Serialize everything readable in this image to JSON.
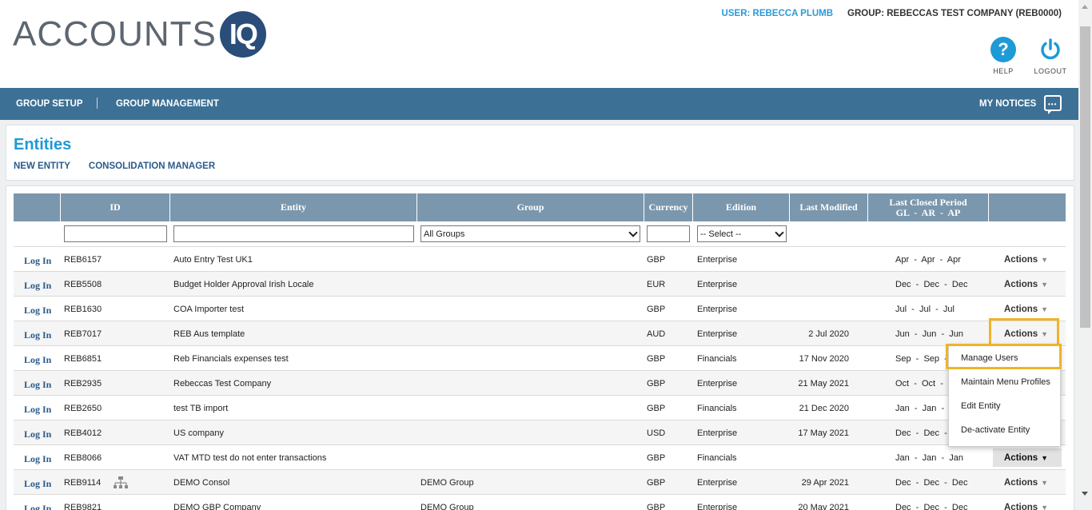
{
  "header": {
    "logo_text": "ACCOUNTS",
    "logo_badge": "IQ",
    "user": "USER: REBECCA PLUMB",
    "group": "GROUP: REBECCAS TEST COMPANY (REB0000)",
    "help_label": "HELP",
    "logout_label": "LOGOUT"
  },
  "nav": {
    "group_setup": "GROUP SETUP",
    "group_management": "GROUP MANAGEMENT",
    "my_notices": "MY NOTICES"
  },
  "page": {
    "title": "Entities",
    "new_entity": "NEW ENTITY",
    "consolidation_manager": "CONSOLIDATION MANAGER"
  },
  "table": {
    "headers": {
      "id": "ID",
      "entity": "Entity",
      "group": "Group",
      "currency": "Currency",
      "edition": "Edition",
      "last_modified": "Last Modified",
      "last_closed_line1": "Last Closed Period",
      "last_closed_line2": "GL  -  AR  -  AP"
    },
    "filters": {
      "group_selected": "All Groups",
      "edition_selected": "-- Select --"
    },
    "login_label": "Log In",
    "actions_label": "Actions",
    "rows": [
      {
        "id": "REB6157",
        "entity": "Auto Entry Test UK1",
        "group": "",
        "currency": "GBP",
        "edition": "Enterprise",
        "modified": "",
        "period": "Apr  -  Apr  -  Apr"
      },
      {
        "id": "REB5508",
        "entity": "Budget Holder Approval Irish Locale",
        "group": "",
        "currency": "EUR",
        "edition": "Enterprise",
        "modified": "",
        "period": "Dec  -  Dec  -  Dec"
      },
      {
        "id": "REB1630",
        "entity": "COA Importer test",
        "group": "",
        "currency": "GBP",
        "edition": "Enterprise",
        "modified": "",
        "period": "Jul  -  Jul  -  Jul"
      },
      {
        "id": "REB7017",
        "entity": "REB Aus template",
        "group": "",
        "currency": "AUD",
        "edition": "Enterprise",
        "modified": "2 Jul 2020",
        "period": "Jun  -  Jun  -  Jun"
      },
      {
        "id": "REB6851",
        "entity": "Reb Financials expenses test",
        "group": "",
        "currency": "GBP",
        "edition": "Financials",
        "modified": "17 Nov 2020",
        "period": "Sep  -  Sep  -"
      },
      {
        "id": "REB2935",
        "entity": "Rebeccas Test Company",
        "group": "",
        "currency": "GBP",
        "edition": "Enterprise",
        "modified": "21 May 2021",
        "period": "Oct  -  Oct  -"
      },
      {
        "id": "REB2650",
        "entity": "test TB import",
        "group": "",
        "currency": "GBP",
        "edition": "Financials",
        "modified": "21 Dec 2020",
        "period": "Jan  -  Jan  -"
      },
      {
        "id": "REB4012",
        "entity": "US company",
        "group": "",
        "currency": "USD",
        "edition": "Enterprise",
        "modified": "17 May 2021",
        "period": "Dec  -  Dec  -"
      },
      {
        "id": "REB8066",
        "entity": "VAT MTD test do not enter transactions",
        "group": "",
        "currency": "GBP",
        "edition": "Financials",
        "modified": "",
        "period": "Jan  -  Jan  -  Jan"
      },
      {
        "id": "REB9114",
        "entity": "DEMO Consol",
        "group": "DEMO Group",
        "currency": "GBP",
        "edition": "Enterprise",
        "modified": "29 Apr 2021",
        "period": "Dec  -  Dec  -  Dec"
      },
      {
        "id": "REB9821",
        "entity": "DEMO GBP Company",
        "group": "DEMO Group",
        "currency": "GBP",
        "edition": "Enterprise",
        "modified": "20 May 2021",
        "period": "Dec  -  Dec  -  Dec"
      }
    ]
  },
  "menu": {
    "items": [
      "Manage Users",
      "Maintain Menu Profiles",
      "Edit Entity",
      "De-activate Entity"
    ]
  },
  "colors": {
    "accent": "#1e9ad6",
    "navbar": "#3d7095",
    "header_row": "#7b97ad",
    "highlight": "#f0b429"
  }
}
